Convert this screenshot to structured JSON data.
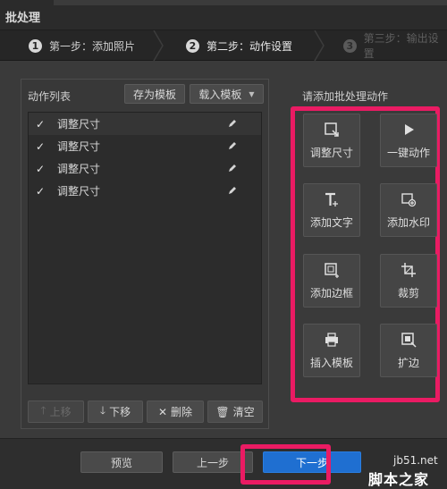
{
  "window": {
    "title": "批处理"
  },
  "steps": [
    {
      "num": "1",
      "label": "第一步：添加照片"
    },
    {
      "num": "2",
      "label": "第二步：动作设置"
    },
    {
      "num": "3",
      "label": "第三步：输出设置"
    }
  ],
  "actions_list": {
    "heading": "动作列表",
    "save_template": "存为模板",
    "load_template": "载入模板",
    "items": [
      {
        "check": "✓",
        "label": "调整尺寸"
      },
      {
        "check": "✓",
        "label": "调整尺寸"
      },
      {
        "check": "✓",
        "label": "调整尺寸"
      },
      {
        "check": "✓",
        "label": "调整尺寸"
      }
    ],
    "buttons": {
      "move_up": "上移",
      "move_down": "下移",
      "delete": "删除",
      "clear": "清空"
    }
  },
  "add_actions": {
    "heading": "请添加批处理动作",
    "items": [
      {
        "label": "调整尺寸",
        "icon": "resize-icon"
      },
      {
        "label": "一键动作",
        "icon": "play-icon"
      },
      {
        "label": "添加文字",
        "icon": "text-icon"
      },
      {
        "label": "添加水印",
        "icon": "watermark-icon"
      },
      {
        "label": "添加边框",
        "icon": "border-icon"
      },
      {
        "label": "裁剪",
        "icon": "crop-icon"
      },
      {
        "label": "插入模板",
        "icon": "template-icon"
      },
      {
        "label": "扩边",
        "icon": "expand-icon"
      }
    ]
  },
  "footer": {
    "preview": "预览",
    "prev": "上一步",
    "next": "下一步"
  },
  "watermark": {
    "line1": "jb51.net",
    "line2": "脚本之家"
  },
  "colors": {
    "highlight": "#ea1b63",
    "primary_button": "#1f6fd1"
  }
}
